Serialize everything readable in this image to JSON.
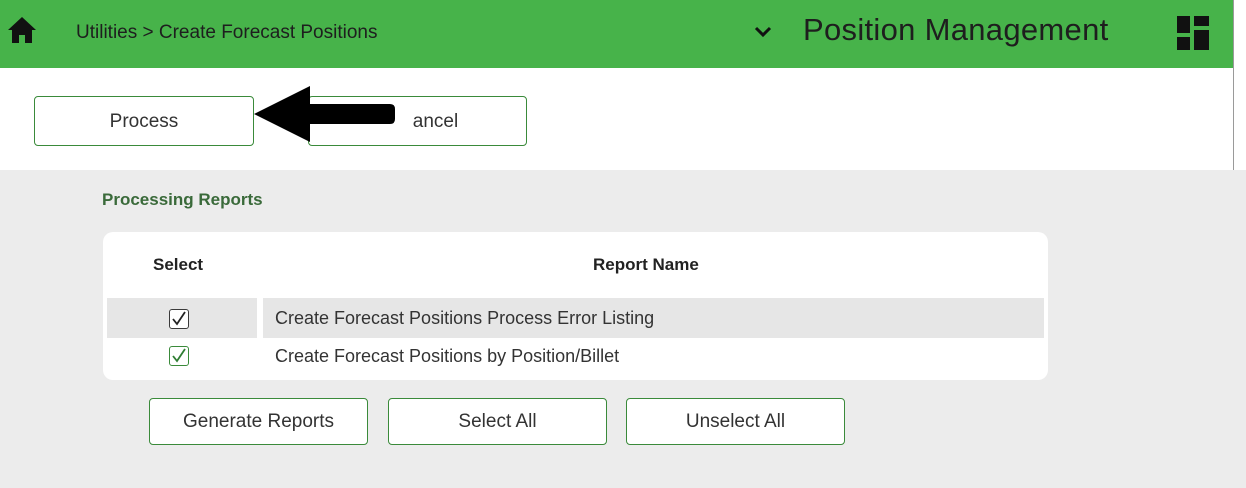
{
  "header": {
    "breadcrumb": "Utilities > Create Forecast Positions",
    "app_title": "Position Management",
    "icons": {
      "home": "home-icon",
      "expand": "chevron-down-icon",
      "apps": "dashboard-grid-icon"
    },
    "accent_color": "#47b34a"
  },
  "toolbar": {
    "process_label": "Process",
    "cancel_label": "ancel"
  },
  "reports": {
    "section_title": "Processing Reports",
    "columns": {
      "select": "Select",
      "name": "Report Name"
    },
    "rows": [
      {
        "name": "Create Forecast Positions Process Error Listing",
        "checked": true
      },
      {
        "name": "Create Forecast Positions by Position/Billet",
        "checked": true
      }
    ],
    "buttons": {
      "generate": "Generate Reports",
      "select_all": "Select All",
      "unselect_all": "Unselect All"
    }
  },
  "annotation": {
    "type": "arrow-left-icon",
    "color": "#000000"
  }
}
